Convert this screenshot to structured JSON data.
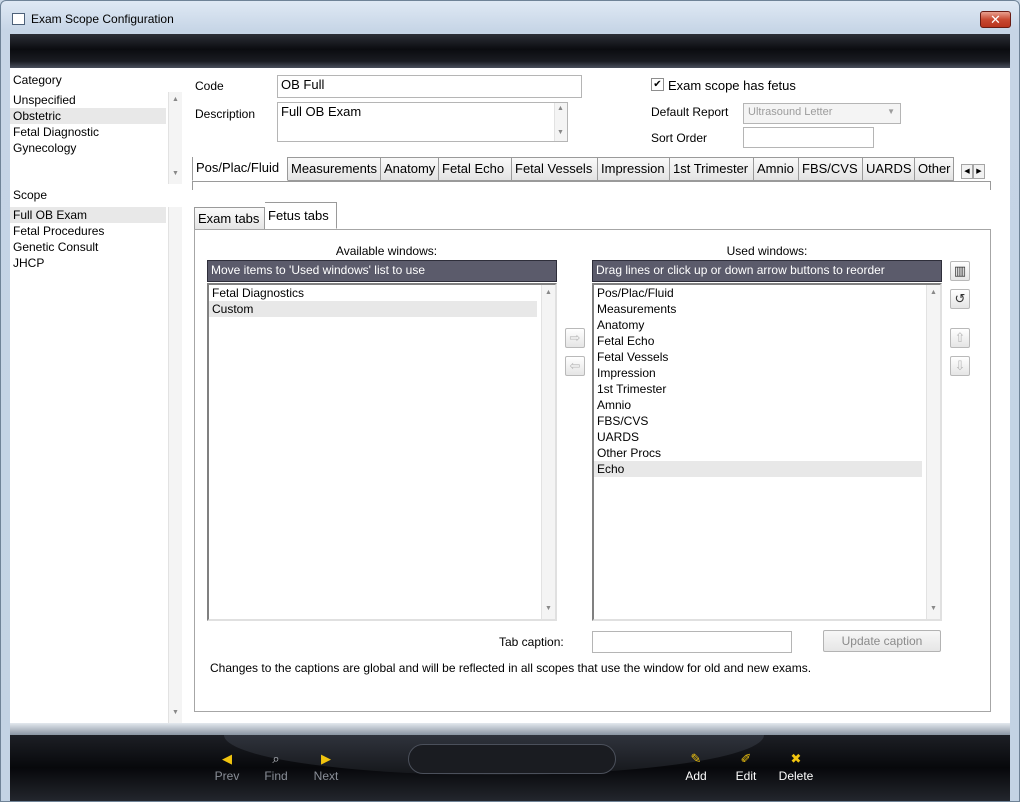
{
  "window": {
    "title": "Exam Scope Configuration",
    "close_glyph": "✕"
  },
  "category": {
    "header": "Category",
    "items": [
      "Unspecified",
      "Obstetric",
      "Fetal Diagnostic",
      "Gynecology"
    ]
  },
  "scope": {
    "header": "Scope",
    "items": [
      "Full OB Exam",
      "Fetal Procedures",
      "Genetic Consult",
      "JHCP"
    ]
  },
  "form": {
    "code_label": "Code",
    "code_value": "OB Full",
    "description_label": "Description",
    "description_value": "Full OB Exam",
    "fetus_checkbox_label": "Exam scope has fetus",
    "fetus_checked": true,
    "default_report_label": "Default Report",
    "default_report_value": "Ultrasound Letter",
    "sort_order_label": "Sort Order",
    "sort_order_value": ""
  },
  "main_tabs": [
    "Pos/Plac/Fluid",
    "Measurements",
    "Anatomy",
    "Fetal Echo",
    "Fetal Vessels",
    "Impression",
    "1st Trimester",
    "Amnio",
    "FBS/CVS",
    "UARDS",
    "Other Procs"
  ],
  "main_tabs_active": 0,
  "sub_tabs": [
    "Exam tabs",
    "Fetus tabs"
  ],
  "sub_tabs_active": 1,
  "available": {
    "title": "Available windows:",
    "header": "Move items to 'Used windows' list to use",
    "items": [
      "Fetal Diagnostics",
      "Custom"
    ]
  },
  "used": {
    "title": "Used windows:",
    "header": "Drag lines or click up or down arrow buttons to reorder",
    "items": [
      "Pos/Plac/Fluid",
      "Measurements",
      "Anatomy",
      "Fetal Echo",
      "Fetal Vessels",
      "Impression",
      "1st Trimester",
      "Amnio",
      "FBS/CVS",
      "UARDS",
      "Other Procs",
      "Echo"
    ]
  },
  "tab_caption": {
    "label": "Tab caption:",
    "value": "",
    "update_button": "Update caption"
  },
  "note": "Changes to the captions are global and will be reflected in all scopes that use the window for old and new exams.",
  "nav": {
    "prev": "Prev",
    "find": "Find",
    "next": "Next",
    "add": "Add",
    "edit": "Edit",
    "delete": "Delete"
  },
  "colors": {
    "list_header_bg": "#5b5b6b",
    "accent_gold": "#f1c40f"
  }
}
